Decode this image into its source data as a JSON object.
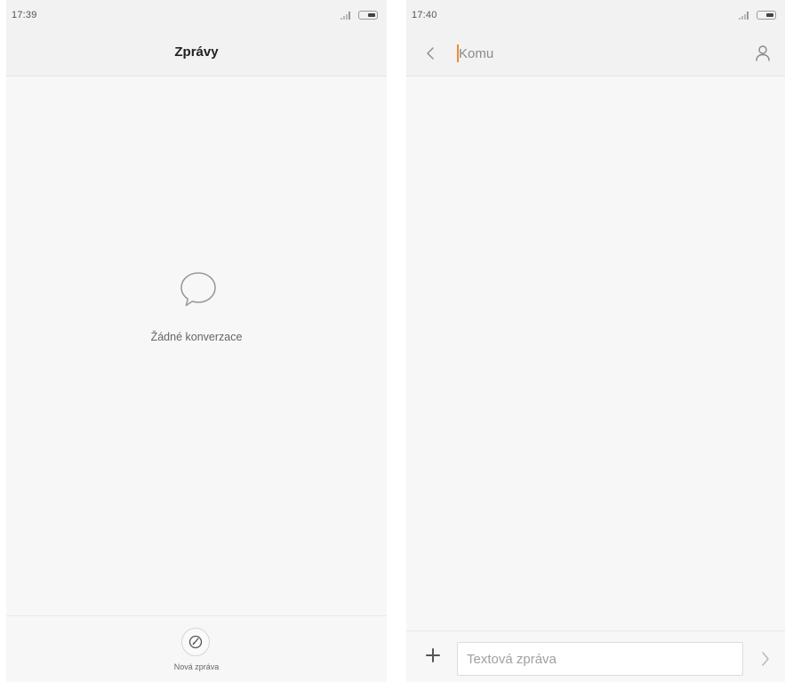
{
  "screens": {
    "inbox": {
      "status_time": "17:39",
      "title": "Zprávy",
      "empty_state": "Žádné konverzace",
      "new_message_label": "Nová zpráva"
    },
    "compose": {
      "status_time": "17:40",
      "to_placeholder": "Komu",
      "message_placeholder": "Textová zpráva"
    }
  },
  "icons": {
    "empty": "speech-bubble-icon",
    "compose": "compose-icon",
    "back": "chevron-left-icon",
    "contact": "person-icon",
    "attach": "plus-icon",
    "send": "chevron-right-icon",
    "signal": "signal-icon",
    "battery": "battery-icon"
  },
  "colors": {
    "background": "#f7f7f7",
    "bar": "#f2f2f2",
    "caret": "#f08a2c",
    "text": "#222222",
    "muted": "#8a8a8a"
  }
}
